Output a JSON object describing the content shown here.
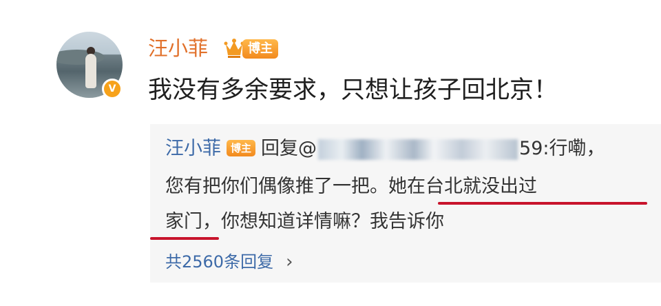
{
  "post": {
    "author": "汪小菲",
    "badge": "博主",
    "verified_mark": "V",
    "content": "我没有多余要求，只想让孩子回北京！"
  },
  "reply": {
    "author": "汪小菲",
    "badge": "博主",
    "reply_prefix": "回复@",
    "mention_tail": "59:行嘞，",
    "line2": "您有把你们偶像推了一把。她在台北就没出过",
    "line3": "家门，你想知道详情嘛？我告诉你",
    "reply_count": "共2560条回复",
    "chevron": "›"
  },
  "icons": {
    "crown": "crown-icon",
    "chevron": "chevron-right-icon",
    "verified": "verified-badge-icon"
  },
  "colors": {
    "username": "#e1702a",
    "link": "#3d6aa8",
    "badge": "#f28a1e",
    "underline": "#c8142c",
    "reply_bg": "#f6f6f6"
  }
}
